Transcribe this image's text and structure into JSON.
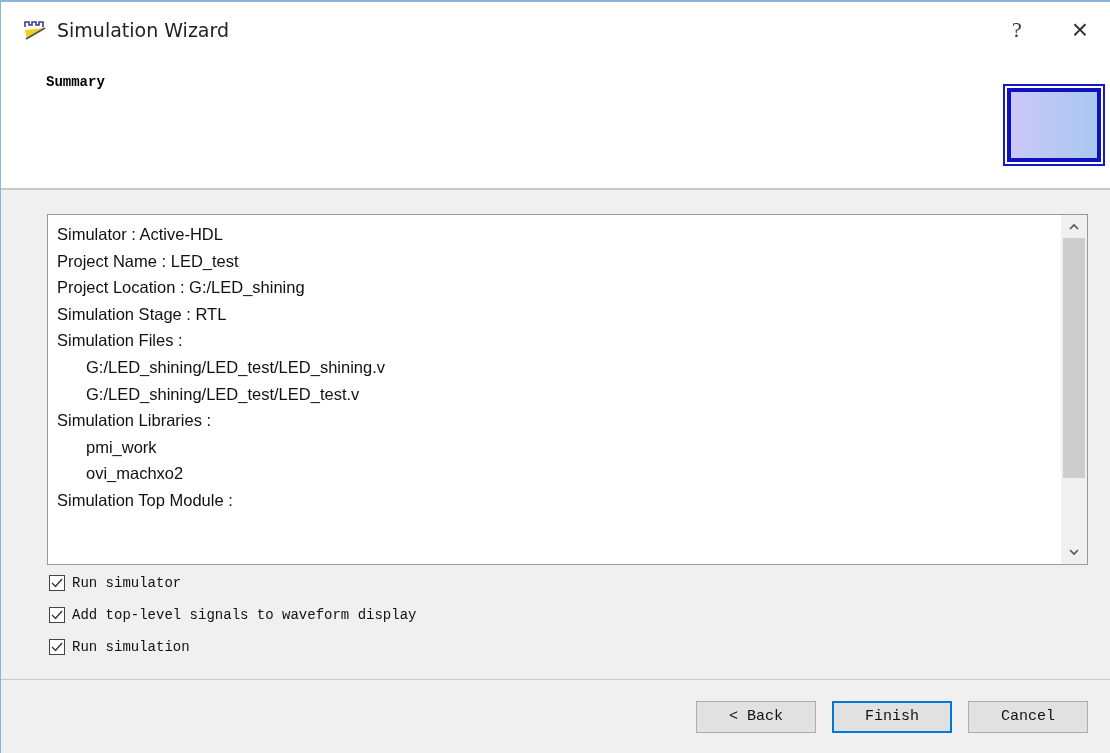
{
  "window": {
    "title": "Simulation Wizard",
    "help": "?",
    "close": "×"
  },
  "header": {
    "title": "Summary"
  },
  "summary": [
    {
      "text": "Simulator : Active-HDL"
    },
    {
      "text": "Project Name : LED_test"
    },
    {
      "text": "Project Location : G:/LED_shining"
    },
    {
      "text": "Simulation Stage : RTL"
    },
    {
      "text": "Simulation Files :",
      "children": [
        {
          "text": "G:/LED_shining/LED_test/LED_shining.v"
        },
        {
          "text": "G:/LED_shining/LED_test/LED_test.v"
        }
      ]
    },
    {
      "text": "Simulation Libraries :",
      "children": [
        {
          "text": "pmi_work"
        },
        {
          "text": "ovi_machxo2"
        }
      ]
    },
    {
      "text": "Simulation Top Module :"
    }
  ],
  "options": [
    {
      "label": "Run simulator",
      "checked": true
    },
    {
      "label": "Add top-level signals to waveform display",
      "checked": true
    },
    {
      "label": "Run simulation",
      "checked": true
    }
  ],
  "buttons": [
    {
      "label": "< Back",
      "default": false
    },
    {
      "label": "Finish",
      "default": true
    },
    {
      "label": "Cancel",
      "default": false
    }
  ]
}
